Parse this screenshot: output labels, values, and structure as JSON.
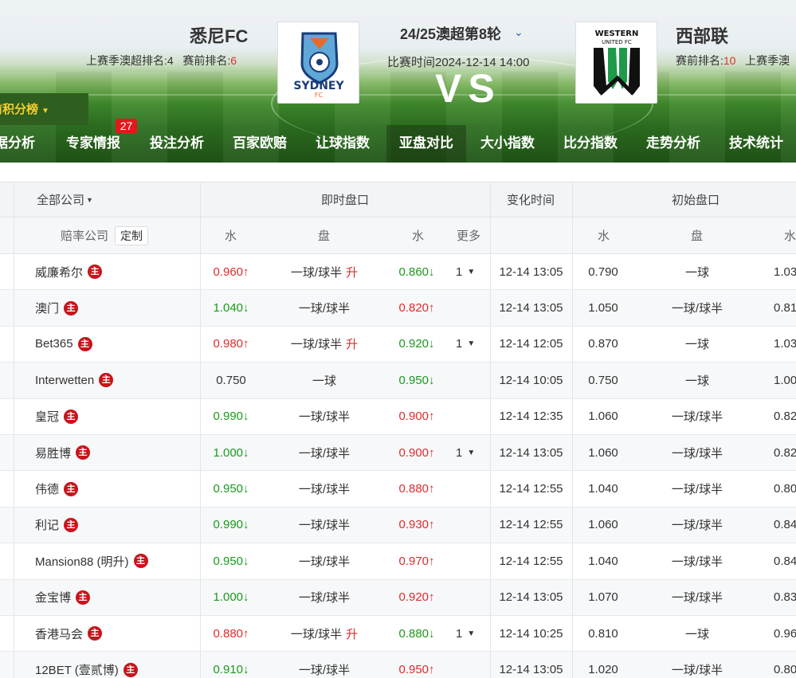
{
  "header": {
    "home": {
      "name": "悉尼FC",
      "last_season_label": "上赛季澳超排名:",
      "last_season_rank": "4",
      "pre_rank_label": "赛前排名:",
      "pre_rank": "6",
      "logo_text": "SYDNEY",
      "logo_sub": "FC"
    },
    "away": {
      "name": "西部联",
      "pre_rank_label": "赛前排名:",
      "pre_rank": "10",
      "last_season_label": "上赛季澳",
      "logo_text1": "WESTERN",
      "logo_text2": "UNITED FC"
    },
    "round": "24/25澳超第8轮",
    "match_time": "比赛时间2024-12-14 14:00",
    "vs": "VS",
    "points_tab": "前积分榜"
  },
  "nav": {
    "items": [
      "据分析",
      "专家情报",
      "投注分析",
      "百家欧赔",
      "让球指数",
      "亚盘对比",
      "大小指数",
      "比分指数",
      "走势分析",
      "技术统计"
    ],
    "active": "亚盘对比",
    "badge": "27"
  },
  "table": {
    "header1": {
      "company_filter": "全部公司",
      "live": "即时盘口",
      "change_time": "变化时间",
      "initial": "初始盘口"
    },
    "header2": {
      "company": "赔率公司",
      "custom": "定制",
      "water1": "水",
      "handicap": "盘",
      "water2": "水",
      "more": "更多",
      "init_water1": "水",
      "init_handicap": "盘",
      "init_water2": "水"
    },
    "zhu_label": "主",
    "rise_label": "升",
    "up_arrow": "↑",
    "down_arrow": "↓",
    "rows": [
      {
        "company": "威廉希尔",
        "w1": "0.960",
        "w1_dir": "up",
        "hc": "一球/球半",
        "rise": true,
        "w2": "0.860",
        "w2_dir": "down",
        "more": "1",
        "time": "12-14 13:05",
        "iw1": "0.790",
        "ihc": "一球",
        "iw2": "1.03"
      },
      {
        "company": "澳门",
        "w1": "1.040",
        "w1_dir": "down",
        "hc": "一球/球半",
        "rise": false,
        "w2": "0.820",
        "w2_dir": "up",
        "more": "",
        "time": "12-14 13:05",
        "iw1": "1.050",
        "ihc": "一球/球半",
        "iw2": "0.81"
      },
      {
        "company": "Bet365",
        "w1": "0.980",
        "w1_dir": "up",
        "hc": "一球/球半",
        "rise": true,
        "w2": "0.920",
        "w2_dir": "down",
        "more": "1",
        "time": "12-14 12:05",
        "iw1": "0.870",
        "ihc": "一球",
        "iw2": "1.03"
      },
      {
        "company": "Interwetten",
        "w1": "0.750",
        "w1_dir": "none",
        "hc": "一球",
        "rise": false,
        "w2": "0.950",
        "w2_dir": "down",
        "more": "",
        "time": "12-14 10:05",
        "iw1": "0.750",
        "ihc": "一球",
        "iw2": "1.00"
      },
      {
        "company": "皇冠",
        "w1": "0.990",
        "w1_dir": "down",
        "hc": "一球/球半",
        "rise": false,
        "w2": "0.900",
        "w2_dir": "up",
        "more": "",
        "time": "12-14 12:35",
        "iw1": "1.060",
        "ihc": "一球/球半",
        "iw2": "0.82"
      },
      {
        "company": "易胜博",
        "w1": "1.000",
        "w1_dir": "down",
        "hc": "一球/球半",
        "rise": false,
        "w2": "0.900",
        "w2_dir": "up",
        "more": "1",
        "time": "12-14 13:05",
        "iw1": "1.060",
        "ihc": "一球/球半",
        "iw2": "0.82"
      },
      {
        "company": "伟德",
        "w1": "0.950",
        "w1_dir": "down",
        "hc": "一球/球半",
        "rise": false,
        "w2": "0.880",
        "w2_dir": "up",
        "more": "",
        "time": "12-14 12:55",
        "iw1": "1.040",
        "ihc": "一球/球半",
        "iw2": "0.80"
      },
      {
        "company": "利记",
        "w1": "0.990",
        "w1_dir": "down",
        "hc": "一球/球半",
        "rise": false,
        "w2": "0.930",
        "w2_dir": "up",
        "more": "",
        "time": "12-14 12:55",
        "iw1": "1.060",
        "ihc": "一球/球半",
        "iw2": "0.84"
      },
      {
        "company": "Mansion88 (明升)",
        "w1": "0.950",
        "w1_dir": "down",
        "hc": "一球/球半",
        "rise": false,
        "w2": "0.970",
        "w2_dir": "up",
        "more": "",
        "time": "12-14 12:55",
        "iw1": "1.040",
        "ihc": "一球/球半",
        "iw2": "0.84"
      },
      {
        "company": "金宝博",
        "w1": "1.000",
        "w1_dir": "down",
        "hc": "一球/球半",
        "rise": false,
        "w2": "0.920",
        "w2_dir": "up",
        "more": "",
        "time": "12-14 13:05",
        "iw1": "1.070",
        "ihc": "一球/球半",
        "iw2": "0.83"
      },
      {
        "company": "香港马会",
        "w1": "0.880",
        "w1_dir": "up",
        "hc": "一球/球半",
        "rise": true,
        "w2": "0.880",
        "w2_dir": "down",
        "more": "1",
        "time": "12-14 10:25",
        "iw1": "0.810",
        "ihc": "一球",
        "iw2": "0.96"
      },
      {
        "company": "12BET (壹贰博)",
        "w1": "0.910",
        "w1_dir": "down",
        "hc": "一球/球半",
        "rise": false,
        "w2": "0.950",
        "w2_dir": "up",
        "more": "",
        "time": "12-14 13:05",
        "iw1": "1.020",
        "ihc": "一球/球半",
        "iw2": "0.80"
      }
    ]
  },
  "colors": {
    "up": "#e02b2b",
    "down": "#1a9a1a",
    "badge": "#e01a1a",
    "points_tab_text": "#f2cf2e"
  }
}
